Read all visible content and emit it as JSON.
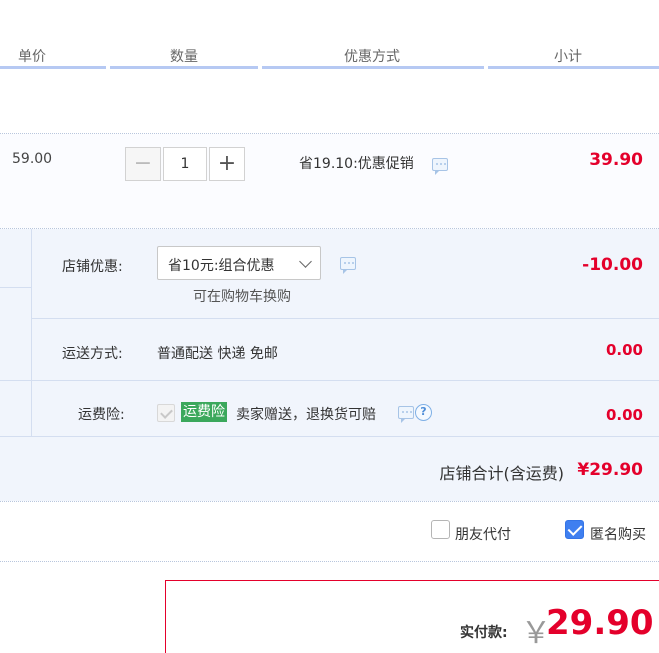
{
  "header": {
    "col_price": "单价",
    "col_qty": "数量",
    "col_promo": "优惠方式",
    "col_subtotal": "小计"
  },
  "item": {
    "unit_price": "59.00",
    "quantity": "1",
    "promo_text": "省19.10:优惠促销",
    "subtotal": "39.90"
  },
  "shop": {
    "coupon_label": "店铺优惠:",
    "coupon_selected": "省10元:组合优惠",
    "coupon_exchange_link": "可在购物车换购",
    "coupon_value": "-10.00",
    "shipping_label": "运送方式:",
    "shipping_method": "普通配送 快递 免邮",
    "shipping_value": "0.00",
    "insurance_label": "运费险:",
    "insurance_tag": "运费险",
    "insurance_desc": "卖家赠送，退换货可赔",
    "insurance_value": "0.00",
    "total_label": "店铺合计(含运费)",
    "total_value": "¥29.90"
  },
  "options": {
    "friend_pay_label": "朋友代付",
    "friend_pay_checked": false,
    "anonymous_label": "匿名购买",
    "anonymous_checked": true
  },
  "payment": {
    "label": "实付款:",
    "currency_symbol": "￥",
    "amount": "29.90"
  },
  "colors": {
    "accent_red": "#e4002b",
    "checkbox_blue": "#3f7ff0",
    "tag_green": "#3ba85c",
    "header_line": "#b6c9f3"
  }
}
